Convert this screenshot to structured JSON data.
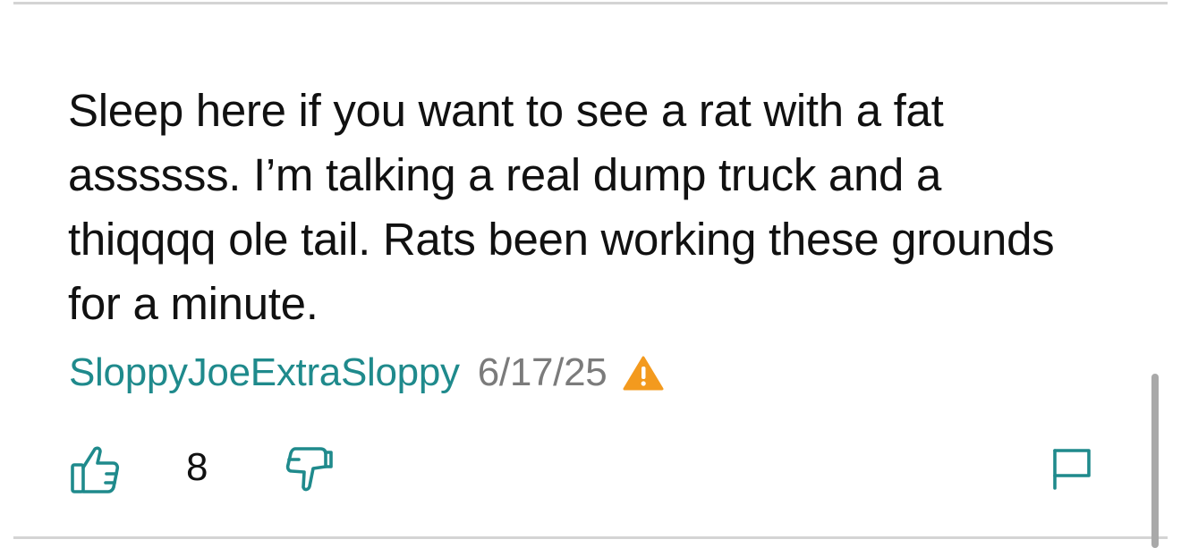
{
  "comment": {
    "text": "Sleep here if you want to see a rat with a fat assssss. I’m talking a real dump truck and a thiqqqq ole tail. Rats been working these grounds for a minute.",
    "author": "SloppyJoeExtraSloppy",
    "date": "6/17/25",
    "warning_icon": "warning-triangle-icon"
  },
  "actions": {
    "upvote_icon": "thumbs-up-icon",
    "vote_count": "8",
    "downvote_icon": "thumbs-down-icon",
    "flag_icon": "flag-icon"
  },
  "colors": {
    "accent": "#1f8a8c",
    "text": "#111111",
    "muted": "#7b7b7b",
    "warning": "#f39a1e",
    "divider": "#d4d4d4"
  }
}
